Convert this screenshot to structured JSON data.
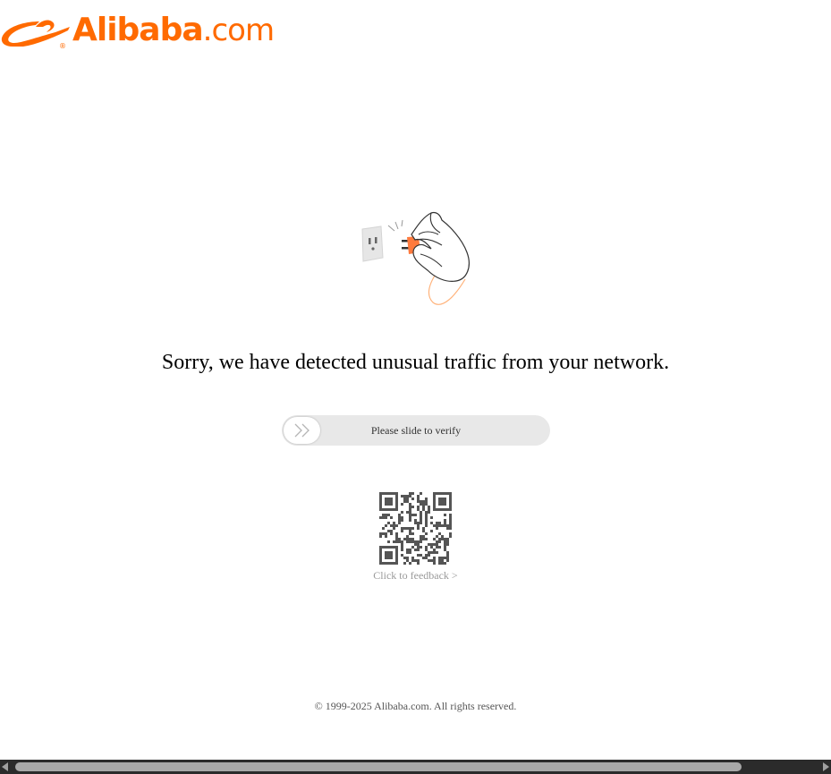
{
  "logo": {
    "brand": "Alibaba",
    "tld": ".com",
    "registered": "®",
    "color": "#ff6a00"
  },
  "illustration": {
    "icon": "unplugged-icon"
  },
  "message": "Sorry, we have detected unusual traffic from your network.",
  "slider": {
    "label": "Please slide to verify",
    "handle_icon": "double-chevron-right-icon",
    "progress": 0
  },
  "qr": {
    "icon": "qr-code-icon"
  },
  "feedback": {
    "label": "Click to feedback >"
  },
  "footer": {
    "copyright": "© 1999-2025 Alibaba.com. All rights reserved."
  },
  "colors": {
    "accent": "#ff6a00",
    "slider_track": "#e8e8e8",
    "feedback_text": "#999999"
  }
}
